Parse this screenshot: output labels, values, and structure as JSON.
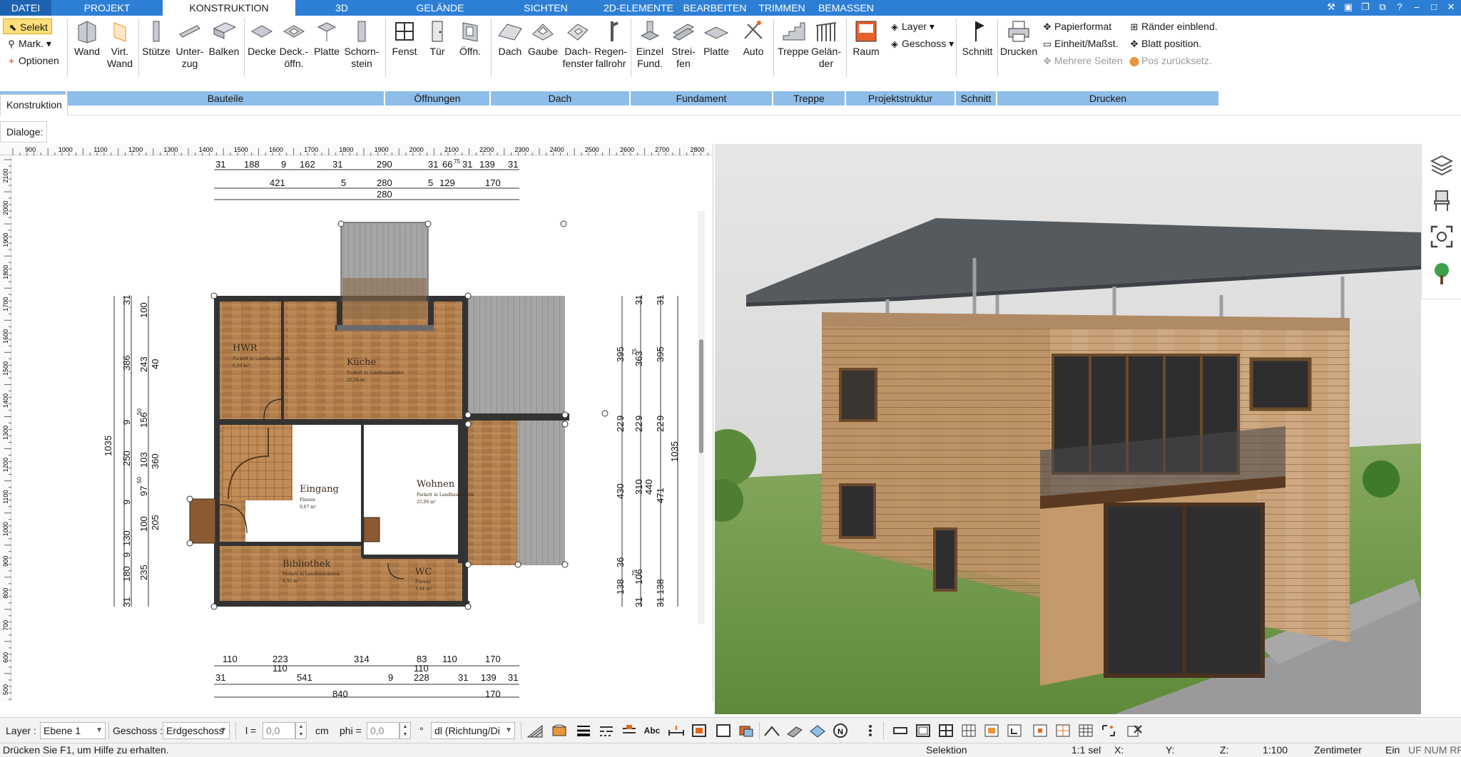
{
  "menu": {
    "tabs": [
      "DATEI",
      "PROJEKT",
      "KONSTRUKTION",
      "3D",
      "GELÄNDE",
      "SICHTEN",
      "2D-ELEMENTE",
      "BEARBEITEN",
      "TRIMMEN",
      "BEMASSEN"
    ],
    "active_tab": "KONSTRUKTION"
  },
  "ribbon": {
    "auswahl": {
      "selekt": "Selekt",
      "mark": "Mark.",
      "optionen": "Optionen"
    },
    "bauteile": {
      "wand": "Wand",
      "virt_wand_1": "Virt.",
      "virt_wand_2": "Wand",
      "stuetze": "Stütze",
      "unterzug_1": "Unter-",
      "unterzug_2": "zug",
      "balken": "Balken",
      "decke": "Decke",
      "deckoeffn_1": "Deck.-",
      "deckoeffn_2": "öffn.",
      "platte": "Platte",
      "schornstein_1": "Schorn-",
      "schornstein_2": "stein"
    },
    "oeffnungen": {
      "fenst": "Fenst",
      "tuer": "Tür",
      "oeffn": "Öffn."
    },
    "dach": {
      "dach": "Dach",
      "gaube": "Gaube",
      "dachfenster_1": "Dach-",
      "dachfenster_2": "fenster",
      "regenfallrohr_1": "Regen-",
      "regenfallrohr_2": "fallrohr"
    },
    "fundament": {
      "einzel_1": "Einzel",
      "einzel_2": "Fund.",
      "streifen_1": "Strei-",
      "streifen_2": "fen",
      "platte": "Platte",
      "auto": "Auto"
    },
    "treppe": {
      "treppe": "Treppe",
      "gelaender_1": "Gelän-",
      "gelaender_2": "der"
    },
    "projektstruktur": {
      "raum": "Raum",
      "layer": "Layer",
      "geschoss": "Geschoss"
    },
    "schnitt": {
      "schnitt": "Schnitt"
    },
    "drucken": {
      "drucken": "Drucken",
      "papierformat": "Papierformat",
      "einheit": "Einheit/Maßst.",
      "mehrere_seiten": "Mehrere Seiten",
      "raender": "Ränder einblend.",
      "blatt": "Blatt position.",
      "pos": "Pos zurücksetz."
    },
    "groups": [
      "Auswahl",
      "Bauteile",
      "Öffnungen",
      "Dach",
      "Fundament",
      "Treppe",
      "Projektstruktur",
      "Schnitt",
      "Drucken"
    ]
  },
  "dialog_tabs": {
    "konstruktion": "Konstruktion",
    "dialoge": "Dialoge:"
  },
  "plan": {
    "ruler_top": [
      "900",
      "1000",
      "1100",
      "1200",
      "1300",
      "1400",
      "1500",
      "1600",
      "1700",
      "1800",
      "1900",
      "2000",
      "2100",
      "2200",
      "2300",
      "2400",
      "2500",
      "2600",
      "2700",
      "2800"
    ],
    "ruler_left": [
      "2100",
      "2000",
      "1900",
      "1800",
      "1700",
      "1600",
      "1500",
      "1400",
      "1300",
      "1200",
      "1100",
      "1000",
      "900",
      "800",
      "700",
      "600",
      "500"
    ],
    "rooms": [
      {
        "name": "HWR",
        "sub": "Parkett in Landhausdielen",
        "area": "9,09 m²"
      },
      {
        "name": "Küche",
        "sub": "Parkett in Landhausdielen",
        "area": "26,54 m²"
      },
      {
        "name": "Eingang",
        "sub": "Fliesen",
        "area": "9,67 m²"
      },
      {
        "name": "Wohnen",
        "sub": "Parkett in Landhausdielen",
        "area": "25,09 m²"
      },
      {
        "name": "Bibliothek",
        "sub": "Parkett in Landhausdielen",
        "area": "9,31 m²"
      },
      {
        "name": "WC",
        "sub": "Fliesen",
        "area": "3,84 m²"
      }
    ],
    "dim_top_row1": [
      "31",
      "188",
      "9",
      "162",
      "31",
      "290",
      "31",
      "66",
      "75",
      "31",
      "139",
      "31"
    ],
    "dim_top_row2": [
      "421",
      "5",
      "280",
      "5",
      "129",
      "170"
    ],
    "dim_top_row3": [
      "280"
    ],
    "dim_bottom_row1": [
      "110",
      "223",
      "314",
      "83",
      "110",
      "170"
    ],
    "dim_bottom_row2": [
      "110",
      "110"
    ],
    "dim_bottom_row3": [
      "31",
      "541",
      "9",
      "228",
      "31",
      "139",
      "31"
    ],
    "dim_bottom_row4": [
      "840",
      "170"
    ],
    "dim_left_a": [
      "31",
      "386",
      "9",
      "250",
      "9",
      "130",
      "9",
      "180",
      "31"
    ],
    "dim_left_b": [
      "100",
      "243",
      "156",
      "50",
      "103",
      "97",
      "50",
      "100",
      "235"
    ],
    "dim_left_c": [
      "40",
      "360",
      "205"
    ],
    "dim_left_total": "1035",
    "dim_right_a": [
      "395",
      "9",
      "22",
      "430",
      "36",
      "138"
    ],
    "dim_right_b": [
      "31",
      "363",
      "75",
      "9",
      "22",
      "310",
      "440",
      "106",
      "75",
      "31"
    ],
    "dim_right_c": [
      "31",
      "395",
      "9",
      "22",
      "471",
      "138",
      "31"
    ],
    "dim_right_total": "1035"
  },
  "bottom": {
    "layer_label": "Layer :",
    "layer_value": "Ebene 1",
    "geschoss_label": "Geschoss :",
    "geschoss_value": "Erdgeschoss",
    "l_label": "l =",
    "l_value": "0,0",
    "cm": "cm",
    "phi_label": "phi =",
    "phi_value": "0,0",
    "degree": "°",
    "mode_value": "dl (Richtung/Di"
  },
  "status": {
    "help": "Drücken Sie F1, um Hilfe zu erhalten.",
    "mode": "Selektion",
    "scale_sel": "1:1 sel",
    "x": "X:",
    "y": "Y:",
    "z": "Z:",
    "scale": "1:100",
    "unit": "Zentimeter",
    "ein": "Ein",
    "flags": "UF NUM RF"
  },
  "colors": {
    "menu_blue": "#2d7fd6",
    "group_blue": "#8fbde9",
    "selekt_yellow": "#ffdf7a",
    "wall": "#3a3a3a",
    "parquet": "#b07d4b",
    "sky": "#dedede",
    "grass": "#6f9a4c"
  }
}
